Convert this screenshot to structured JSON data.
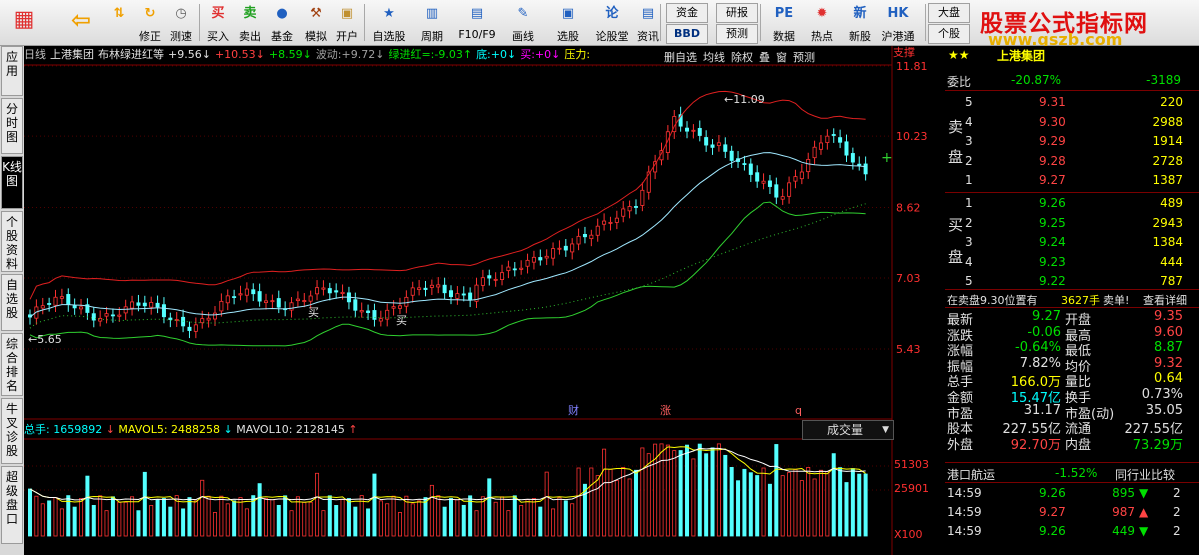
{
  "toolbar": {
    "buttons": [
      {
        "label": "",
        "icon": "grid-icon",
        "color": "#e03030"
      },
      {
        "label": "",
        "icon": "back-arrow-icon",
        "color": "#f0a000"
      },
      {
        "label": "",
        "icon": "up-down-icon",
        "color": "#f0a000"
      },
      {
        "label": "修正",
        "icon": "refresh-icon",
        "color": "#f0a000"
      },
      {
        "label": "测速",
        "icon": "clock-icon",
        "color": "#606060"
      },
      {
        "label": "买入",
        "icon": "buy-icon",
        "color": "#e03030"
      },
      {
        "label": "卖出",
        "icon": "sell-icon",
        "color": "#20a020"
      },
      {
        "label": "基金",
        "icon": "fund-icon",
        "color": "#2060c0"
      },
      {
        "label": "模拟",
        "icon": "hammer-icon",
        "color": "#a04010"
      },
      {
        "label": "开户",
        "icon": "lock-icon",
        "color": "#c09030"
      },
      {
        "label": "自选股",
        "icon": "star-icon",
        "color": "#2060c0"
      },
      {
        "label": "周期",
        "icon": "period-icon",
        "color": "#2060c0"
      },
      {
        "label": "F10/F9",
        "icon": "f10-icon",
        "color": "#2060c0"
      },
      {
        "label": "画线",
        "icon": "pen-icon",
        "color": "#2060c0"
      },
      {
        "label": "选股",
        "icon": "select-icon",
        "color": "#2060c0"
      },
      {
        "label": "论股堂",
        "icon": "forum-icon",
        "color": "#2060c0"
      },
      {
        "label": "资讯",
        "icon": "info-icon",
        "color": "#2060c0"
      },
      {
        "label": "数据",
        "icon": "pe-icon",
        "color": "#2060c0"
      },
      {
        "label": "热点",
        "icon": "hot-icon",
        "color": "#e03030"
      },
      {
        "label": "新股",
        "icon": "new-stock-icon",
        "color": "#2060c0"
      },
      {
        "label": "沪港通",
        "icon": "hk-connect-icon",
        "color": "#2060c0"
      }
    ],
    "small": {
      "zijin": "资金",
      "bbd": "BBD",
      "yanbao": "研报",
      "yuce": "预测",
      "dapan": "大盘",
      "gegu": "个股"
    },
    "logo_title": "股票公式指标网",
    "logo_url": "www.gszb.com"
  },
  "left_tabs": [
    "应用",
    "分时图",
    "K线图",
    "个股资料",
    "自选股",
    "综合排名",
    "牛叉诊股",
    "超级盘口"
  ],
  "chart": {
    "header": [
      {
        "t": "日线",
        "c": "#c0c0c0"
      },
      {
        "t": "上港集团",
        "c": "#e0e0e0"
      },
      {
        "t": "布林绿进红等",
        "c": "#e0e0e0"
      },
      {
        "t": "+9.56↓",
        "c": "#e0e0e0"
      },
      {
        "t": "+10.53↓",
        "c": "#ff4040"
      },
      {
        "t": "+8.59↓",
        "c": "#00e000"
      },
      {
        "t": "波动:+9.72↓",
        "c": "#a0a0a0"
      },
      {
        "t": "绿进红=:-9.03↑",
        "c": "#00e000"
      },
      {
        "t": "底:+0↓",
        "c": "#00ffff"
      },
      {
        "t": "买:+0↓",
        "c": "#ff00ff"
      },
      {
        "t": "压力:",
        "c": "#ffff00"
      }
    ],
    "header_buttons": [
      "删自选",
      "均线",
      "除权",
      "叠",
      "窗",
      "预测"
    ],
    "price_ticks": [
      "11.81",
      "10.23",
      "8.62",
      "7.03",
      "5.43"
    ],
    "support_label": "支撑",
    "annotation_high": "11.09",
    "annotation_low": "5.65",
    "marker_cai": "财",
    "marker_zhang": "涨",
    "marker_q": "q",
    "buy_markers": [
      "买",
      "买"
    ],
    "volume_header": {
      "zongshou": "总手: 1659892",
      "mavol5": "MAVOL5: 2488258",
      "mavol10": "MAVOL10: 2128145"
    },
    "volume_dropdown": "成交量",
    "volume_ticks": [
      "51303",
      "25901",
      "X100"
    ]
  },
  "chart_data": {
    "type": "candlestick",
    "title": "",
    "price_axis_ticks": [
      11.81,
      10.23,
      8.62,
      7.03,
      5.43
    ],
    "volume_axis_ticks": [
      51303,
      25901
    ],
    "high_label": 11.09,
    "low_label": 5.65
  },
  "right_panel": {
    "title": "上港集团",
    "weibi_label": "委比",
    "weibi_value": "-20.87%",
    "weicha": "-3189",
    "sell_label": [
      "卖",
      "盘"
    ],
    "buy_label": [
      "买",
      "盘"
    ],
    "sell": [
      {
        "n": "5",
        "p": "9.31",
        "v": "220"
      },
      {
        "n": "4",
        "p": "9.30",
        "v": "2988"
      },
      {
        "n": "3",
        "p": "9.29",
        "v": "1914"
      },
      {
        "n": "2",
        "p": "9.28",
        "v": "2728"
      },
      {
        "n": "1",
        "p": "9.27",
        "v": "1387"
      }
    ],
    "buy": [
      {
        "n": "1",
        "p": "9.26",
        "v": "489"
      },
      {
        "n": "2",
        "p": "9.25",
        "v": "2943"
      },
      {
        "n": "3",
        "p": "9.24",
        "v": "1384"
      },
      {
        "n": "4",
        "p": "9.23",
        "v": "444"
      },
      {
        "n": "5",
        "p": "9.22",
        "v": "787"
      }
    ],
    "status": {
      "a": "在卖盘9.30位置有",
      "b": "3627手",
      "c": "卖单!",
      "d": "查看详细"
    },
    "stats": [
      {
        "l1": "最新",
        "v1": "9.27",
        "c1": "green",
        "l2": "开盘",
        "v2": "9.35",
        "c2": "red"
      },
      {
        "l1": "涨跌",
        "v1": "-0.06",
        "c1": "green",
        "l2": "最高",
        "v2": "9.60",
        "c2": "red"
      },
      {
        "l1": "涨幅",
        "v1": "-0.64%",
        "c1": "green",
        "l2": "最低",
        "v2": "8.87",
        "c2": "green"
      },
      {
        "l1": "振幅",
        "v1": "7.82%",
        "c1": "white",
        "l2": "均价",
        "v2": "9.32",
        "c2": "red"
      },
      {
        "l1": "总手",
        "v1": "166.0万",
        "c1": "yellow",
        "l2": "量比",
        "v2": "0.64",
        "c2": "yellow"
      },
      {
        "l1": "金额",
        "v1": "15.47亿",
        "c1": "cyan",
        "l2": "换手",
        "v2": "0.73%",
        "c2": "white"
      },
      {
        "l1": "市盈",
        "v1": "31.17",
        "c1": "white",
        "l2": "市盈(动)",
        "v2": "35.05",
        "c2": "white"
      },
      {
        "l1": "股本",
        "v1": "227.55亿",
        "c1": "white",
        "l2": "流通",
        "v2": "227.55亿",
        "c2": "white"
      },
      {
        "l1": "外盘",
        "v1": "92.70万",
        "c1": "red",
        "l2": "内盘",
        "v2": "73.29万",
        "c2": "green"
      }
    ],
    "sector": {
      "name": "港口航运",
      "pct": "-1.52%",
      "link": "同行业比较"
    },
    "ticks": [
      {
        "t": "14:59",
        "p": "9.26",
        "v": "895",
        "dir": "down",
        "n": "2"
      },
      {
        "t": "14:59",
        "p": "9.27",
        "v": "987",
        "dir": "up",
        "n": "2"
      },
      {
        "t": "14:59",
        "p": "9.26",
        "v": "449",
        "dir": "down",
        "n": "2"
      }
    ]
  }
}
